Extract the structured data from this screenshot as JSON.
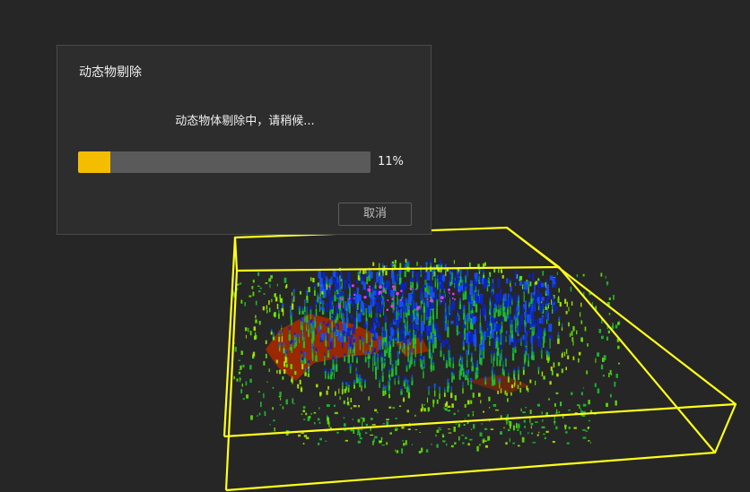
{
  "dialog": {
    "title": "动态物剔除",
    "message": "动态物体剔除中，请稍候...",
    "progress": {
      "value": 0.11,
      "label": "11%",
      "fill_color": "#f5bd00",
      "track_color": "#5a5a5a"
    },
    "cancel_label": "取消"
  },
  "viewport": {
    "background_color": "#262626",
    "bounding_box_color": "#ffff1a",
    "point_cloud_colors": [
      "#0a23c8",
      "#1450ff",
      "#0aa05a",
      "#1ec832",
      "#64f000",
      "#b4f000",
      "#a02800",
      "#d93ce6"
    ]
  }
}
